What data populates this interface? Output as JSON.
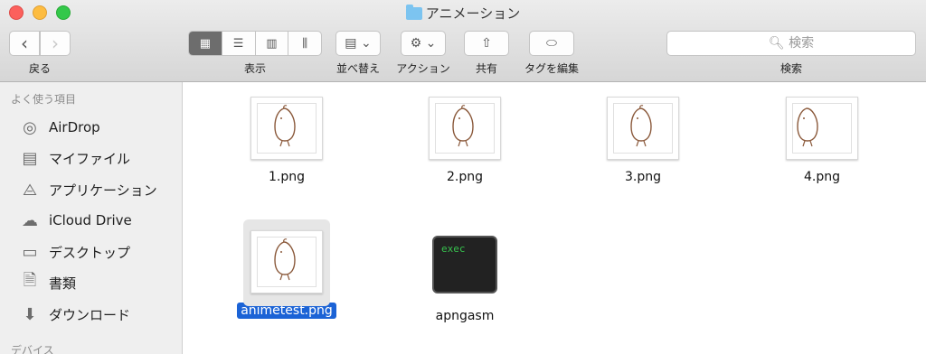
{
  "window": {
    "title": "アニメーション"
  },
  "toolbar": {
    "back_label": "戻る",
    "view_label": "表示",
    "sort_label": "並べ替え",
    "action_label": "アクション",
    "share_label": "共有",
    "tags_label": "タグを編集",
    "search_label": "検索",
    "search_placeholder": "検索"
  },
  "sidebar": {
    "favorites_header": "よく使う項目",
    "items": [
      {
        "label": "AirDrop",
        "icon": "airdrop-icon"
      },
      {
        "label": "マイファイル",
        "icon": "all-files-icon"
      },
      {
        "label": "アプリケーション",
        "icon": "applications-icon"
      },
      {
        "label": "iCloud Drive",
        "icon": "cloud-icon"
      },
      {
        "label": "デスクトップ",
        "icon": "desktop-icon"
      },
      {
        "label": "書類",
        "icon": "documents-icon"
      },
      {
        "label": "ダウンロード",
        "icon": "download-icon"
      }
    ],
    "devices_header": "デバイス"
  },
  "files": [
    {
      "name": "1.png",
      "kind": "image"
    },
    {
      "name": "2.png",
      "kind": "image"
    },
    {
      "name": "3.png",
      "kind": "image"
    },
    {
      "name": "4.png",
      "kind": "image"
    },
    {
      "name": "animetest.png",
      "kind": "image",
      "selected": true
    },
    {
      "name": "apngasm",
      "kind": "exec",
      "badge": "exec"
    }
  ],
  "colors": {
    "selection": "#1b63d6",
    "accent_green": "#37c14e"
  }
}
